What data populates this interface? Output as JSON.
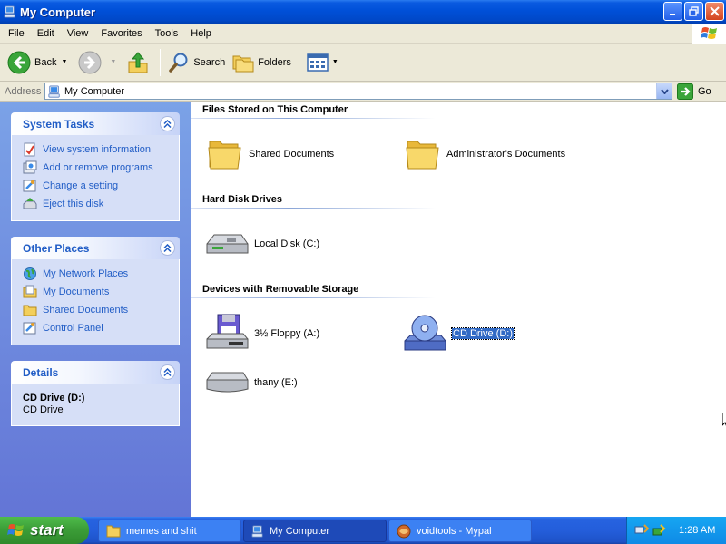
{
  "window": {
    "title": "My Computer"
  },
  "menu": [
    "File",
    "Edit",
    "View",
    "Favorites",
    "Tools",
    "Help"
  ],
  "toolbar": {
    "back": "Back",
    "search": "Search",
    "folders": "Folders"
  },
  "address": {
    "label": "Address",
    "value": "My Computer",
    "go": "Go"
  },
  "sidebar": {
    "system_tasks": {
      "title": "System Tasks",
      "items": [
        "View system information",
        "Add or remove programs",
        "Change a setting",
        "Eject this disk"
      ]
    },
    "other_places": {
      "title": "Other Places",
      "items": [
        "My Network Places",
        "My Documents",
        "Shared Documents",
        "Control Panel"
      ]
    },
    "details": {
      "title": "Details",
      "name": "CD Drive (D:)",
      "type": "CD Drive"
    }
  },
  "content": {
    "groups": [
      {
        "title": "Files Stored on This Computer",
        "items": [
          "Shared Documents",
          "Administrator's Documents"
        ]
      },
      {
        "title": "Hard Disk Drives",
        "items": [
          "Local Disk (C:)"
        ]
      },
      {
        "title": "Devices with Removable Storage",
        "items": [
          "3½ Floppy (A:)",
          "CD Drive (D:)",
          "thany (E:)"
        ]
      }
    ],
    "selected": "CD Drive (D:)"
  },
  "taskbar": {
    "start": "start",
    "tasks": [
      "memes and shit",
      "My Computer",
      "voidtools - Mypal"
    ],
    "active_task": "My Computer",
    "clock": "1:28 AM"
  },
  "colors": {
    "titlebar": "#0050d8",
    "sidebar_link": "#215dc6",
    "selection": "#316ac5",
    "start": "#3c9e38"
  }
}
